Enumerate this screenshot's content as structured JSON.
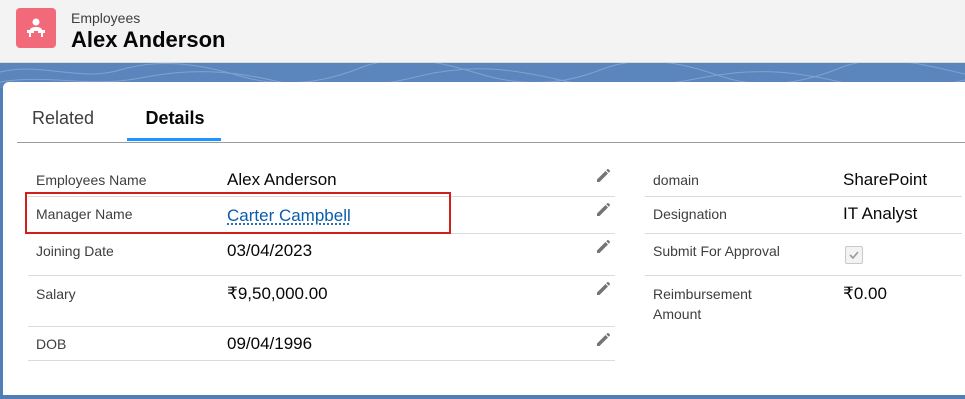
{
  "header": {
    "object_label": "Employees",
    "record_title": "Alex Anderson",
    "icon": "employee-desk-icon"
  },
  "tabs": [
    {
      "label": "Related",
      "active": false
    },
    {
      "label": "Details",
      "active": true
    }
  ],
  "left_fields": [
    {
      "label": "Employees Name",
      "value": "Alex Anderson",
      "editable": true
    },
    {
      "label": "Manager Name",
      "value": "Carter Campbell",
      "link": true,
      "editable": true,
      "highlighted": true
    },
    {
      "label": "Joining Date",
      "value": "03/04/2023",
      "editable": true
    },
    {
      "label": "Salary",
      "value": "₹9,50,000.00",
      "editable": true
    },
    {
      "label": "DOB",
      "value": "09/04/1996",
      "editable": true
    }
  ],
  "right_fields": [
    {
      "label": "domain",
      "value": "SharePoint"
    },
    {
      "label": "Designation",
      "value": "IT Analyst"
    },
    {
      "label": "Submit For Approval",
      "checked": true,
      "disabled": true
    },
    {
      "label_line1": "Reimbursement",
      "label_line2": "Amount",
      "value": "₹0.00"
    }
  ],
  "colors": {
    "accent": "#1b96ff",
    "highlight_border": "#d0201c",
    "link": "#0b5cab",
    "icon_bg": "#f26979",
    "band": "#5b86bd"
  }
}
